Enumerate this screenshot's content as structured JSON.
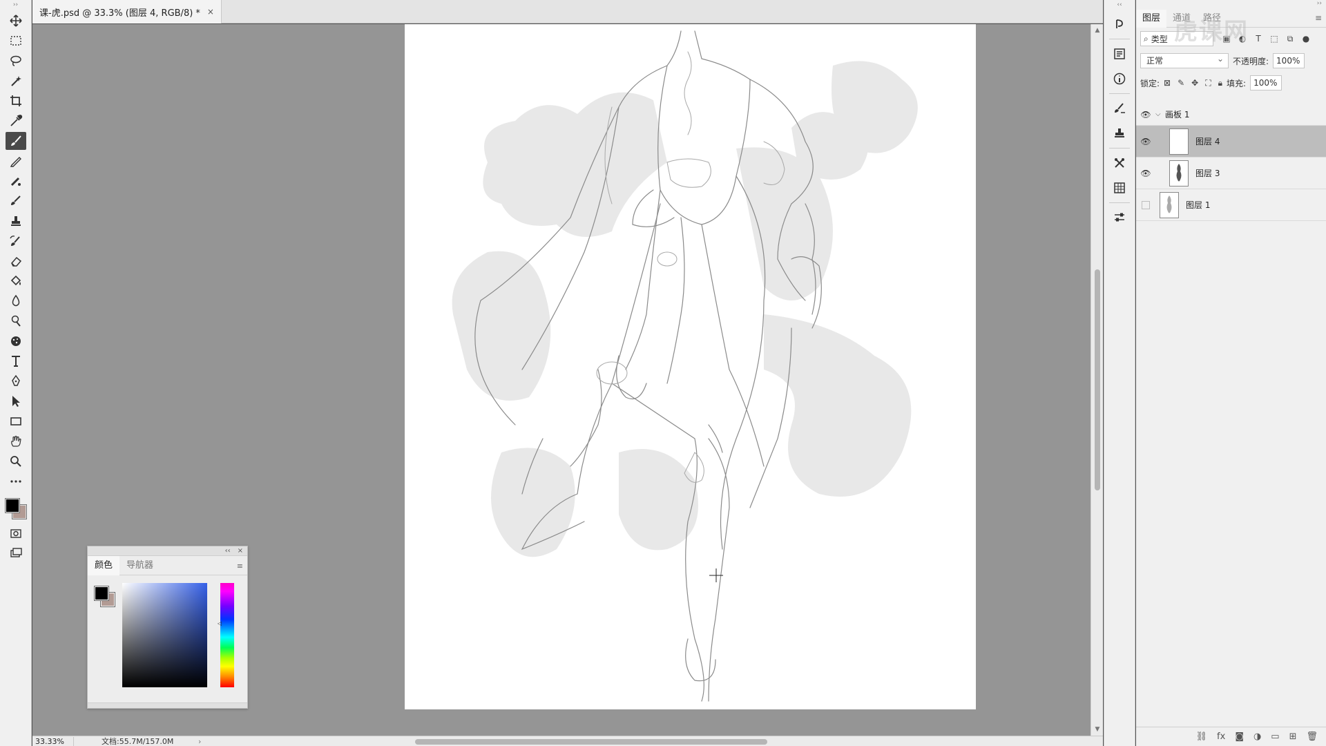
{
  "document": {
    "tab_title": "课-虎.psd @ 33.3% (图层 4, RGB/8) *",
    "close_glyph": "×"
  },
  "toolbar": {
    "tools": [
      "move-tool",
      "marquee-tool",
      "lasso-tool",
      "magic-wand-tool",
      "crop-tool",
      "eyedropper-tool",
      "brush-tool",
      "pencil-tool",
      "healing-brush-tool",
      "mixer-brush-tool",
      "clone-stamp-tool",
      "history-brush-tool",
      "eraser-tool",
      "paint-bucket-tool",
      "blur-tool",
      "dodge-tool",
      "sponge-tool",
      "type-tool",
      "pen-tool",
      "path-selection-tool",
      "rectangle-tool",
      "hand-tool",
      "zoom-tool",
      "more-tools"
    ],
    "active_tool": "brush-tool",
    "foreground_color": "#000000",
    "background_color": "#b29b94"
  },
  "color_panel": {
    "tabs": [
      "颜色",
      "导航器"
    ],
    "active_tab": "颜色",
    "collapse_glyph": "‹‹",
    "close_glyph": "×",
    "menu_glyph": "≡"
  },
  "status_bar": {
    "zoom": "33.33%",
    "doc_info": "文档:55.7M/157.0M",
    "arrow": "›"
  },
  "layers_panel": {
    "tabs": [
      "图层",
      "通道",
      "路径"
    ],
    "active_tab": "图层",
    "filter_label": "类型",
    "blend_mode": "正常",
    "opacity_label": "不透明度:",
    "opacity_value": "100%",
    "lock_label": "锁定:",
    "fill_label": "填充:",
    "fill_value": "100%",
    "group": {
      "name": "画板 1",
      "visible": true,
      "expanded": true
    },
    "layers": [
      {
        "name": "图层 4",
        "visible": true,
        "selected": true
      },
      {
        "name": "图层 3",
        "visible": true,
        "selected": false
      },
      {
        "name": "图层 1",
        "visible": false,
        "selected": false
      }
    ],
    "footer_icons": [
      "link-icon",
      "fx-icon",
      "mask-icon",
      "adjustment-icon",
      "folder-icon",
      "new-layer-icon",
      "trash-icon"
    ]
  },
  "watermark": {
    "text": "虎课网"
  }
}
